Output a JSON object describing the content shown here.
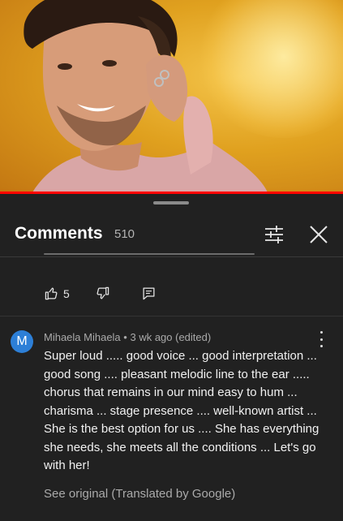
{
  "video": {
    "description_hidden": ""
  },
  "comments_panel": {
    "title": "Comments",
    "count": "510",
    "icons": {
      "filter": "sliders-icon",
      "close": "close-icon"
    }
  },
  "previous_comment_actions": {
    "likes": "5",
    "icons": {
      "like": "thumbs-up-icon",
      "dislike": "thumbs-down-icon",
      "reply": "reply-icon"
    }
  },
  "comment": {
    "avatar_letter": "M",
    "avatar_color": "#2d7fd7",
    "author": "Mihaela Mihaela",
    "time": "3 wk ago (edited)",
    "separator": "•",
    "text": "Super loud ..... good voice ... good interpretation ... good song .... pleasant melodic line to the ear ..... chorus that remains in our mind easy to hum ... charisma ... stage presence .... well-known artist ... She is the best option for us .... She has everything she needs, she meets all the conditions ... Let's go with her!",
    "translate_link": "See original (Translated by Google)"
  },
  "colors": {
    "background": "#212121",
    "progress": "#ff0000",
    "secondary_text": "#aaaaaa"
  }
}
